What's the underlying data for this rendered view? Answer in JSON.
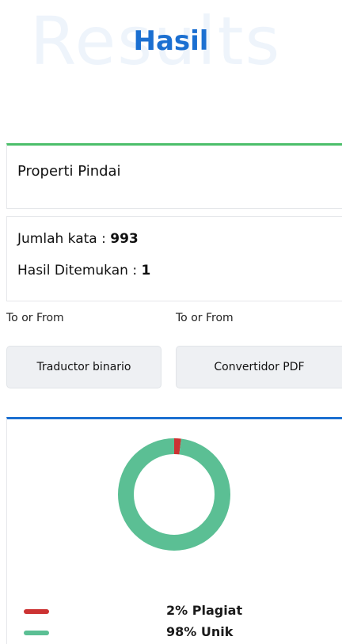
{
  "header": {
    "background_word": "Results",
    "title": "Hasil"
  },
  "scan_properties": {
    "label": "Properti Pindai"
  },
  "stats": {
    "word_count_label": "Jumlah kata : ",
    "word_count_value": "993",
    "results_found_label": "Hasil Ditemukan : ",
    "results_found_value": "1"
  },
  "tools": [
    {
      "caption": "To or From",
      "button_label": "Traductor binario"
    },
    {
      "caption": "To or From",
      "button_label": "Convertidor PDF"
    }
  ],
  "chart_data": {
    "type": "pie",
    "categories": [
      "Plagiat",
      "Unik"
    ],
    "values": [
      2,
      98
    ],
    "colors": [
      "#cc3333",
      "#5bbf94"
    ],
    "legend": [
      "2% Plagiat",
      "98% Unik"
    ],
    "legend_placement": "bottom"
  },
  "colors": {
    "title": "#1b6fd1",
    "scan_accent": "#4cbf6a",
    "chart_accent": "#1b6fd1"
  }
}
